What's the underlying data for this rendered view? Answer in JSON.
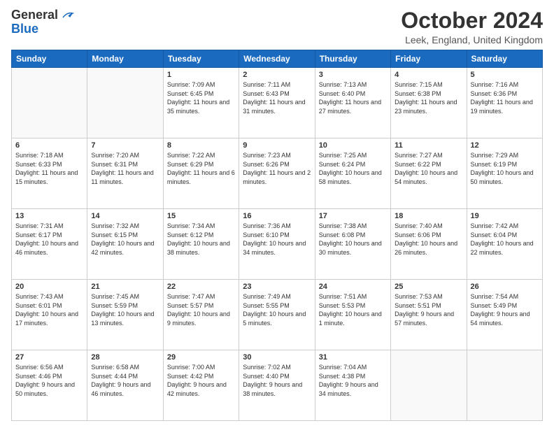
{
  "header": {
    "logo_line1": "General",
    "logo_line2": "Blue",
    "month_title": "October 2024",
    "location": "Leek, England, United Kingdom"
  },
  "days_of_week": [
    "Sunday",
    "Monday",
    "Tuesday",
    "Wednesday",
    "Thursday",
    "Friday",
    "Saturday"
  ],
  "weeks": [
    [
      {
        "day": "",
        "info": ""
      },
      {
        "day": "",
        "info": ""
      },
      {
        "day": "1",
        "info": "Sunrise: 7:09 AM\nSunset: 6:45 PM\nDaylight: 11 hours and 35 minutes."
      },
      {
        "day": "2",
        "info": "Sunrise: 7:11 AM\nSunset: 6:43 PM\nDaylight: 11 hours and 31 minutes."
      },
      {
        "day": "3",
        "info": "Sunrise: 7:13 AM\nSunset: 6:40 PM\nDaylight: 11 hours and 27 minutes."
      },
      {
        "day": "4",
        "info": "Sunrise: 7:15 AM\nSunset: 6:38 PM\nDaylight: 11 hours and 23 minutes."
      },
      {
        "day": "5",
        "info": "Sunrise: 7:16 AM\nSunset: 6:36 PM\nDaylight: 11 hours and 19 minutes."
      }
    ],
    [
      {
        "day": "6",
        "info": "Sunrise: 7:18 AM\nSunset: 6:33 PM\nDaylight: 11 hours and 15 minutes."
      },
      {
        "day": "7",
        "info": "Sunrise: 7:20 AM\nSunset: 6:31 PM\nDaylight: 11 hours and 11 minutes."
      },
      {
        "day": "8",
        "info": "Sunrise: 7:22 AM\nSunset: 6:29 PM\nDaylight: 11 hours and 6 minutes."
      },
      {
        "day": "9",
        "info": "Sunrise: 7:23 AM\nSunset: 6:26 PM\nDaylight: 11 hours and 2 minutes."
      },
      {
        "day": "10",
        "info": "Sunrise: 7:25 AM\nSunset: 6:24 PM\nDaylight: 10 hours and 58 minutes."
      },
      {
        "day": "11",
        "info": "Sunrise: 7:27 AM\nSunset: 6:22 PM\nDaylight: 10 hours and 54 minutes."
      },
      {
        "day": "12",
        "info": "Sunrise: 7:29 AM\nSunset: 6:19 PM\nDaylight: 10 hours and 50 minutes."
      }
    ],
    [
      {
        "day": "13",
        "info": "Sunrise: 7:31 AM\nSunset: 6:17 PM\nDaylight: 10 hours and 46 minutes."
      },
      {
        "day": "14",
        "info": "Sunrise: 7:32 AM\nSunset: 6:15 PM\nDaylight: 10 hours and 42 minutes."
      },
      {
        "day": "15",
        "info": "Sunrise: 7:34 AM\nSunset: 6:12 PM\nDaylight: 10 hours and 38 minutes."
      },
      {
        "day": "16",
        "info": "Sunrise: 7:36 AM\nSunset: 6:10 PM\nDaylight: 10 hours and 34 minutes."
      },
      {
        "day": "17",
        "info": "Sunrise: 7:38 AM\nSunset: 6:08 PM\nDaylight: 10 hours and 30 minutes."
      },
      {
        "day": "18",
        "info": "Sunrise: 7:40 AM\nSunset: 6:06 PM\nDaylight: 10 hours and 26 minutes."
      },
      {
        "day": "19",
        "info": "Sunrise: 7:42 AM\nSunset: 6:04 PM\nDaylight: 10 hours and 22 minutes."
      }
    ],
    [
      {
        "day": "20",
        "info": "Sunrise: 7:43 AM\nSunset: 6:01 PM\nDaylight: 10 hours and 17 minutes."
      },
      {
        "day": "21",
        "info": "Sunrise: 7:45 AM\nSunset: 5:59 PM\nDaylight: 10 hours and 13 minutes."
      },
      {
        "day": "22",
        "info": "Sunrise: 7:47 AM\nSunset: 5:57 PM\nDaylight: 10 hours and 9 minutes."
      },
      {
        "day": "23",
        "info": "Sunrise: 7:49 AM\nSunset: 5:55 PM\nDaylight: 10 hours and 5 minutes."
      },
      {
        "day": "24",
        "info": "Sunrise: 7:51 AM\nSunset: 5:53 PM\nDaylight: 10 hours and 1 minute."
      },
      {
        "day": "25",
        "info": "Sunrise: 7:53 AM\nSunset: 5:51 PM\nDaylight: 9 hours and 57 minutes."
      },
      {
        "day": "26",
        "info": "Sunrise: 7:54 AM\nSunset: 5:49 PM\nDaylight: 9 hours and 54 minutes."
      }
    ],
    [
      {
        "day": "27",
        "info": "Sunrise: 6:56 AM\nSunset: 4:46 PM\nDaylight: 9 hours and 50 minutes."
      },
      {
        "day": "28",
        "info": "Sunrise: 6:58 AM\nSunset: 4:44 PM\nDaylight: 9 hours and 46 minutes."
      },
      {
        "day": "29",
        "info": "Sunrise: 7:00 AM\nSunset: 4:42 PM\nDaylight: 9 hours and 42 minutes."
      },
      {
        "day": "30",
        "info": "Sunrise: 7:02 AM\nSunset: 4:40 PM\nDaylight: 9 hours and 38 minutes."
      },
      {
        "day": "31",
        "info": "Sunrise: 7:04 AM\nSunset: 4:38 PM\nDaylight: 9 hours and 34 minutes."
      },
      {
        "day": "",
        "info": ""
      },
      {
        "day": "",
        "info": ""
      }
    ]
  ]
}
